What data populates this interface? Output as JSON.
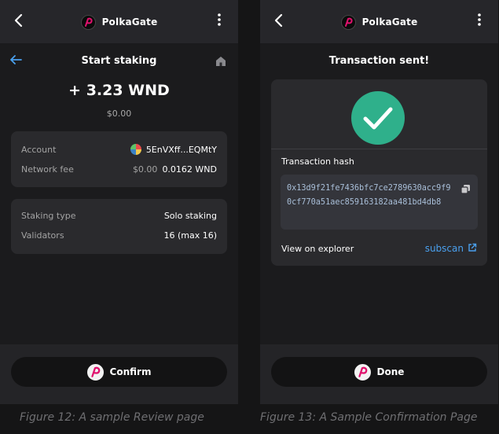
{
  "review": {
    "brand": "PolkaGate",
    "title": "Start staking",
    "amount": "+ 3.23 WND",
    "fiat": "$0.00",
    "account_label": "Account",
    "account_value": "5EnVXff...EQMtY",
    "fee_label": "Network fee",
    "fee_fiat": "$0.00",
    "fee_value": "0.0162 WND",
    "staking_type_label": "Staking type",
    "staking_type_value": "Solo staking",
    "validators_label": "Validators",
    "validators_value": "16 (max 16)",
    "confirm_label": "Confirm"
  },
  "confirmation": {
    "brand": "PolkaGate",
    "title": "Transaction sent!",
    "hash_label": "Transaction hash",
    "hash_value": "0x13d9f21fe7436bfc7ce2789630acc9f90cf770a51aec859163182aa481bd4db8",
    "explorer_label": "View on explorer",
    "explorer_link": "subscan",
    "done_label": "Done"
  },
  "captions": {
    "review": "Figure 12: A sample Review page",
    "confirmation": "Figure 13: A Sample Confirmation Page"
  },
  "icons": [
    "back-chevron-icon",
    "polkagate-logo-icon",
    "kebab-menu-icon",
    "arrow-left-icon",
    "home-icon",
    "account-identicon",
    "check-icon",
    "copy-icon",
    "external-link-icon"
  ],
  "colors": {
    "accent_blue": "#4aa0ee",
    "success_green": "#2fb08b",
    "hash_text": "#a9bfd9"
  }
}
